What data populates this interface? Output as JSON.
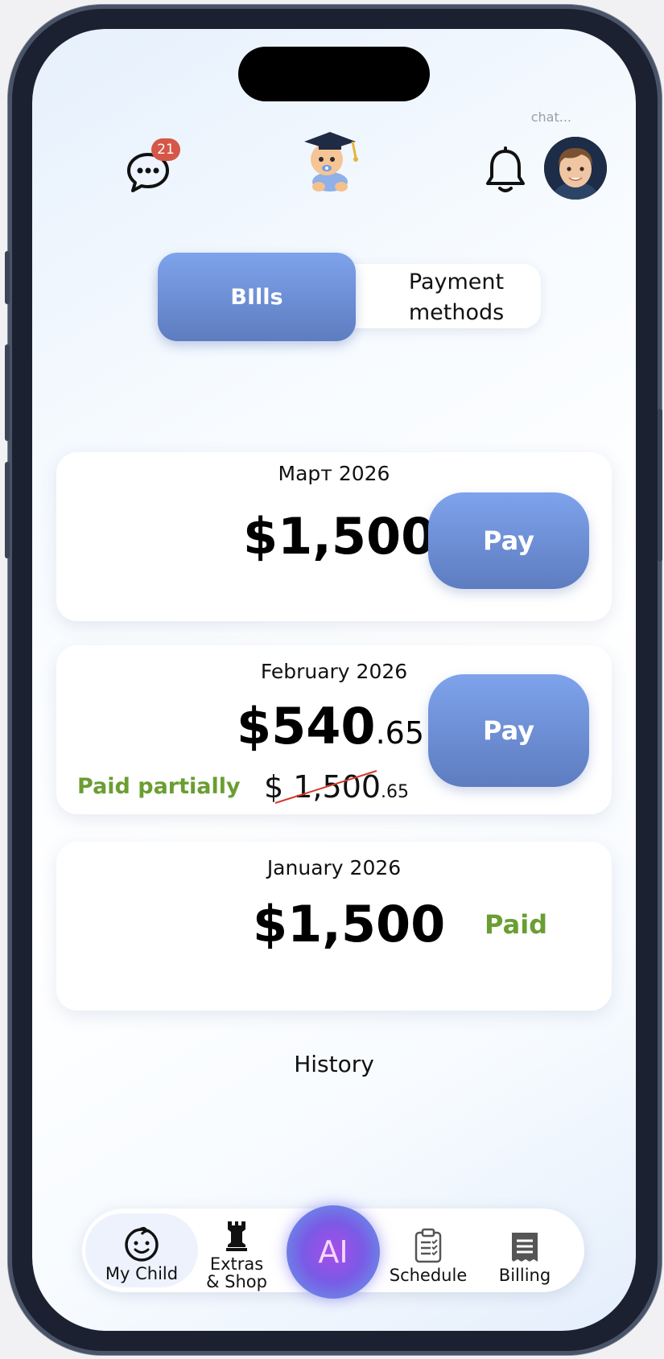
{
  "header": {
    "chat_hint": "chat...",
    "chat_badge_count": "21"
  },
  "segment": {
    "bills_label": "BIlls",
    "payment_methods_label": "Payment methods"
  },
  "bills": [
    {
      "month": "Март 2026",
      "amount": "$1,500",
      "action_label": "Pay"
    },
    {
      "month": "February 2026",
      "amount_main": "$540",
      "amount_cents": ".65",
      "action_label": "Pay",
      "status": "Paid partially",
      "original_main": "$ 1,500",
      "original_cents": ".65"
    },
    {
      "month": "January 2026",
      "amount": "$1,500",
      "status": "Paid"
    }
  ],
  "history_label": "History",
  "tabbar": {
    "my_child": "My Child",
    "extras_line1": "Extras",
    "extras_line2": "& Shop",
    "ai": "AI",
    "schedule": "Schedule",
    "billing": "Billing"
  },
  "colors": {
    "accent": "#7ea3ec",
    "accent_dark": "#5e7cc0",
    "paid_green": "#6a9e32",
    "badge_red": "#d45747"
  }
}
